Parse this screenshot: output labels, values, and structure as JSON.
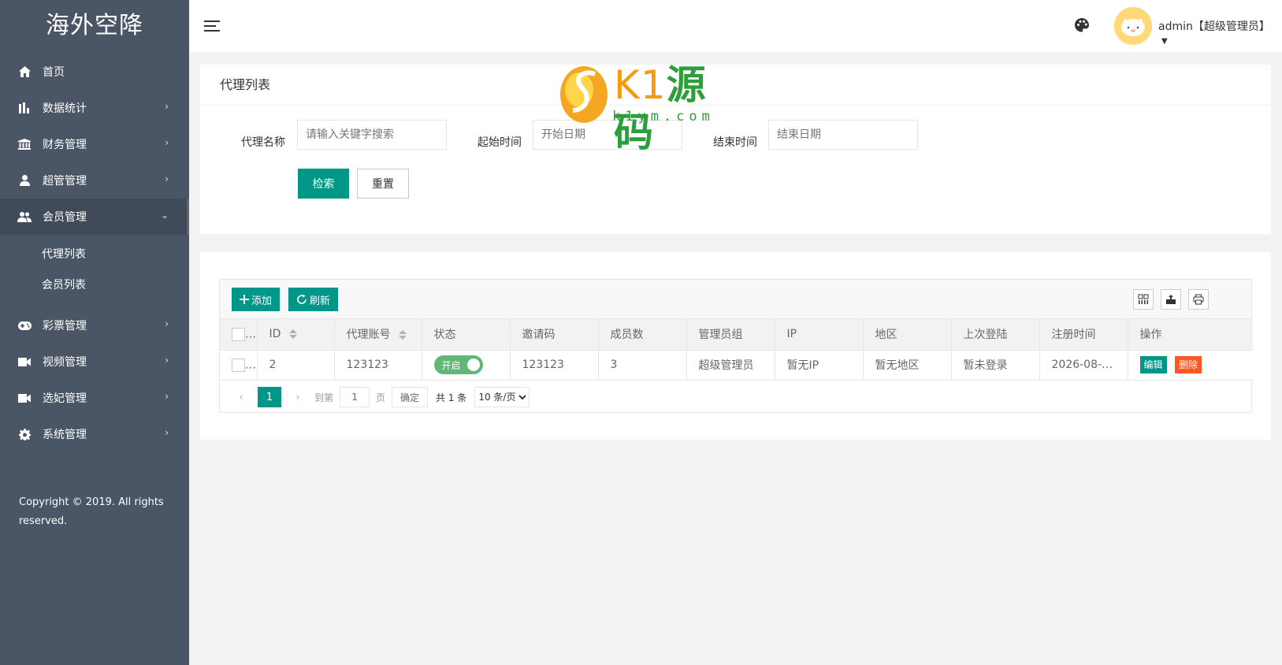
{
  "app": {
    "logo": "海外空降"
  },
  "sidebar": {
    "items": [
      {
        "label": "首页",
        "icon": "home-icon"
      },
      {
        "label": "数据统计",
        "icon": "bar-chart-icon"
      },
      {
        "label": "财务管理",
        "icon": "bank-icon"
      },
      {
        "label": "超管管理",
        "icon": "user-icon"
      },
      {
        "label": "会员管理",
        "icon": "users-icon"
      },
      {
        "label": "彩票管理",
        "icon": "gamepad-icon"
      },
      {
        "label": "视频管理",
        "icon": "video-icon"
      },
      {
        "label": "选妃管理",
        "icon": "camera-icon"
      },
      {
        "label": "系统管理",
        "icon": "gear-icon"
      }
    ],
    "submenu": [
      "代理列表",
      "会员列表"
    ],
    "copyright": "Copyright © 2019. All rights reserved."
  },
  "header": {
    "admin": "admin【超级管理员】"
  },
  "watermark": {
    "brand": "K1",
    "brand2": "源码",
    "url": "k1ym.com"
  },
  "search": {
    "title": "代理列表",
    "name_label": "代理名称",
    "name_placeholder": "请输入关键字搜索",
    "start_label": "起始时间",
    "start_placeholder": "开始日期",
    "end_label": "结束时间",
    "end_placeholder": "结束日期",
    "search_btn": "检索",
    "reset_btn": "重置"
  },
  "table": {
    "add_btn": "添加",
    "refresh_btn": "刷新",
    "columns": [
      "ID",
      "代理账号",
      "状态",
      "邀请码",
      "成员数",
      "管理员组",
      "IP",
      "地区",
      "上次登陆",
      "注册时间",
      "操作"
    ],
    "rows": [
      {
        "id": "2",
        "account": "123123",
        "status": "开启",
        "invite": "123123",
        "members": "3",
        "group": "超级管理员",
        "ip": "暂无IP",
        "region": "暂无地区",
        "last_login": "暂未登录",
        "reg_time": "2026-08-0...",
        "edit": "编辑",
        "delete": "删除"
      }
    ]
  },
  "pager": {
    "current": "1",
    "goto": "到第",
    "page_input": "1",
    "page_unit": "页",
    "confirm": "确定",
    "total": "共 1 条",
    "per_page": "10 条/页"
  }
}
